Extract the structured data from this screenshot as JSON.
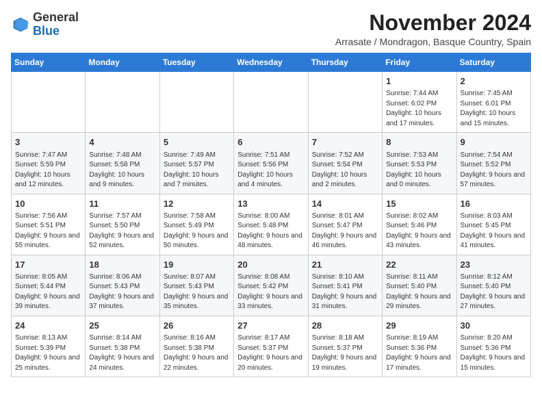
{
  "logo": {
    "general": "General",
    "blue": "Blue"
  },
  "header": {
    "month_year": "November 2024",
    "location": "Arrasate / Mondragon, Basque Country, Spain"
  },
  "weekdays": [
    "Sunday",
    "Monday",
    "Tuesday",
    "Wednesday",
    "Thursday",
    "Friday",
    "Saturday"
  ],
  "weeks": [
    [
      {
        "day": "",
        "info": ""
      },
      {
        "day": "",
        "info": ""
      },
      {
        "day": "",
        "info": ""
      },
      {
        "day": "",
        "info": ""
      },
      {
        "day": "",
        "info": ""
      },
      {
        "day": "1",
        "info": "Sunrise: 7:44 AM\nSunset: 6:02 PM\nDaylight: 10 hours and 17 minutes."
      },
      {
        "day": "2",
        "info": "Sunrise: 7:45 AM\nSunset: 6:01 PM\nDaylight: 10 hours and 15 minutes."
      }
    ],
    [
      {
        "day": "3",
        "info": "Sunrise: 7:47 AM\nSunset: 5:59 PM\nDaylight: 10 hours and 12 minutes."
      },
      {
        "day": "4",
        "info": "Sunrise: 7:48 AM\nSunset: 5:58 PM\nDaylight: 10 hours and 9 minutes."
      },
      {
        "day": "5",
        "info": "Sunrise: 7:49 AM\nSunset: 5:57 PM\nDaylight: 10 hours and 7 minutes."
      },
      {
        "day": "6",
        "info": "Sunrise: 7:51 AM\nSunset: 5:56 PM\nDaylight: 10 hours and 4 minutes."
      },
      {
        "day": "7",
        "info": "Sunrise: 7:52 AM\nSunset: 5:54 PM\nDaylight: 10 hours and 2 minutes."
      },
      {
        "day": "8",
        "info": "Sunrise: 7:53 AM\nSunset: 5:53 PM\nDaylight: 10 hours and 0 minutes."
      },
      {
        "day": "9",
        "info": "Sunrise: 7:54 AM\nSunset: 5:52 PM\nDaylight: 9 hours and 57 minutes."
      }
    ],
    [
      {
        "day": "10",
        "info": "Sunrise: 7:56 AM\nSunset: 5:51 PM\nDaylight: 9 hours and 55 minutes."
      },
      {
        "day": "11",
        "info": "Sunrise: 7:57 AM\nSunset: 5:50 PM\nDaylight: 9 hours and 52 minutes."
      },
      {
        "day": "12",
        "info": "Sunrise: 7:58 AM\nSunset: 5:49 PM\nDaylight: 9 hours and 50 minutes."
      },
      {
        "day": "13",
        "info": "Sunrise: 8:00 AM\nSunset: 5:48 PM\nDaylight: 9 hours and 48 minutes."
      },
      {
        "day": "14",
        "info": "Sunrise: 8:01 AM\nSunset: 5:47 PM\nDaylight: 9 hours and 46 minutes."
      },
      {
        "day": "15",
        "info": "Sunrise: 8:02 AM\nSunset: 5:46 PM\nDaylight: 9 hours and 43 minutes."
      },
      {
        "day": "16",
        "info": "Sunrise: 8:03 AM\nSunset: 5:45 PM\nDaylight: 9 hours and 41 minutes."
      }
    ],
    [
      {
        "day": "17",
        "info": "Sunrise: 8:05 AM\nSunset: 5:44 PM\nDaylight: 9 hours and 39 minutes."
      },
      {
        "day": "18",
        "info": "Sunrise: 8:06 AM\nSunset: 5:43 PM\nDaylight: 9 hours and 37 minutes."
      },
      {
        "day": "19",
        "info": "Sunrise: 8:07 AM\nSunset: 5:43 PM\nDaylight: 9 hours and 35 minutes."
      },
      {
        "day": "20",
        "info": "Sunrise: 8:08 AM\nSunset: 5:42 PM\nDaylight: 9 hours and 33 minutes."
      },
      {
        "day": "21",
        "info": "Sunrise: 8:10 AM\nSunset: 5:41 PM\nDaylight: 9 hours and 31 minutes."
      },
      {
        "day": "22",
        "info": "Sunrise: 8:11 AM\nSunset: 5:40 PM\nDaylight: 9 hours and 29 minutes."
      },
      {
        "day": "23",
        "info": "Sunrise: 8:12 AM\nSunset: 5:40 PM\nDaylight: 9 hours and 27 minutes."
      }
    ],
    [
      {
        "day": "24",
        "info": "Sunrise: 8:13 AM\nSunset: 5:39 PM\nDaylight: 9 hours and 25 minutes."
      },
      {
        "day": "25",
        "info": "Sunrise: 8:14 AM\nSunset: 5:38 PM\nDaylight: 9 hours and 24 minutes."
      },
      {
        "day": "26",
        "info": "Sunrise: 8:16 AM\nSunset: 5:38 PM\nDaylight: 9 hours and 22 minutes."
      },
      {
        "day": "27",
        "info": "Sunrise: 8:17 AM\nSunset: 5:37 PM\nDaylight: 9 hours and 20 minutes."
      },
      {
        "day": "28",
        "info": "Sunrise: 8:18 AM\nSunset: 5:37 PM\nDaylight: 9 hours and 19 minutes."
      },
      {
        "day": "29",
        "info": "Sunrise: 8:19 AM\nSunset: 5:36 PM\nDaylight: 9 hours and 17 minutes."
      },
      {
        "day": "30",
        "info": "Sunrise: 8:20 AM\nSunset: 5:36 PM\nDaylight: 9 hours and 15 minutes."
      }
    ]
  ]
}
